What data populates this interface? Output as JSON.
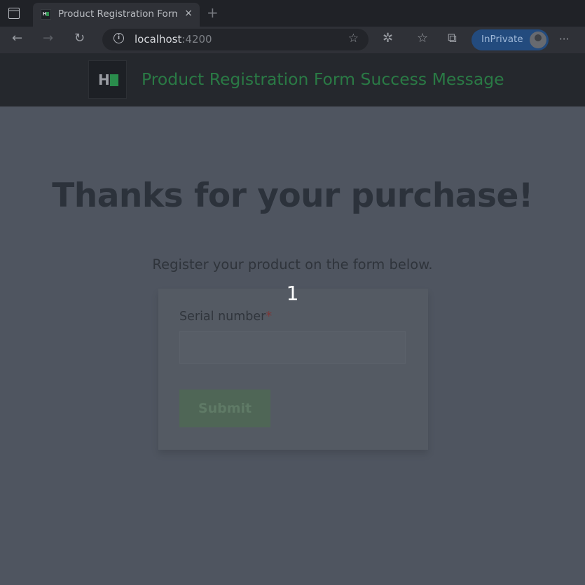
{
  "browser": {
    "tab_title": "Product Registration Form Success Message",
    "tab_close": "×",
    "new_tab": "+",
    "address_host": "localhost",
    "address_port": ":4200",
    "inprivate_label": "InPrivate",
    "icons": {
      "tab_actions": "tab-actions-icon",
      "back": "←",
      "forward": "→",
      "refresh": "↻",
      "info": "i",
      "star_add": "☆",
      "extensions": "✲",
      "favorites": "☆",
      "collections": "⧉",
      "more": "···"
    }
  },
  "header": {
    "logo_letter": "H",
    "title": "Product Registration Form Success Message",
    "colors": {
      "accent": "#2a7a45",
      "background": "#25282d"
    }
  },
  "main": {
    "title": "Thanks for your purchase!",
    "subtitle": "Register your product on the form below.",
    "step_number": "1",
    "form": {
      "serial_label": "Serial number",
      "required_mark": "*",
      "serial_value": "",
      "submit_label": "Submit"
    }
  }
}
